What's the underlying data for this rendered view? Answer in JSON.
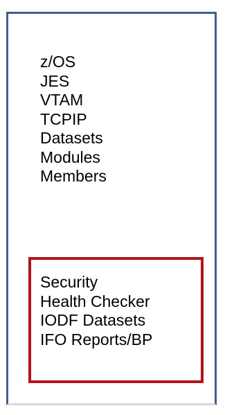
{
  "menu": {
    "main_items": [
      {
        "label": "z/OS"
      },
      {
        "label": "JES"
      },
      {
        "label": "VTAM"
      },
      {
        "label": "TCPIP"
      },
      {
        "label": "Datasets"
      },
      {
        "label": "Modules"
      },
      {
        "label": "Members"
      }
    ],
    "highlighted_items": [
      {
        "label": "Security"
      },
      {
        "label": "Health Checker"
      },
      {
        "label": "IODF Datasets"
      },
      {
        "label": "IFO Reports/BP"
      }
    ]
  },
  "colors": {
    "frame_border": "#3b5f8c",
    "highlight_border": "#b3131b",
    "text": "#000000"
  }
}
